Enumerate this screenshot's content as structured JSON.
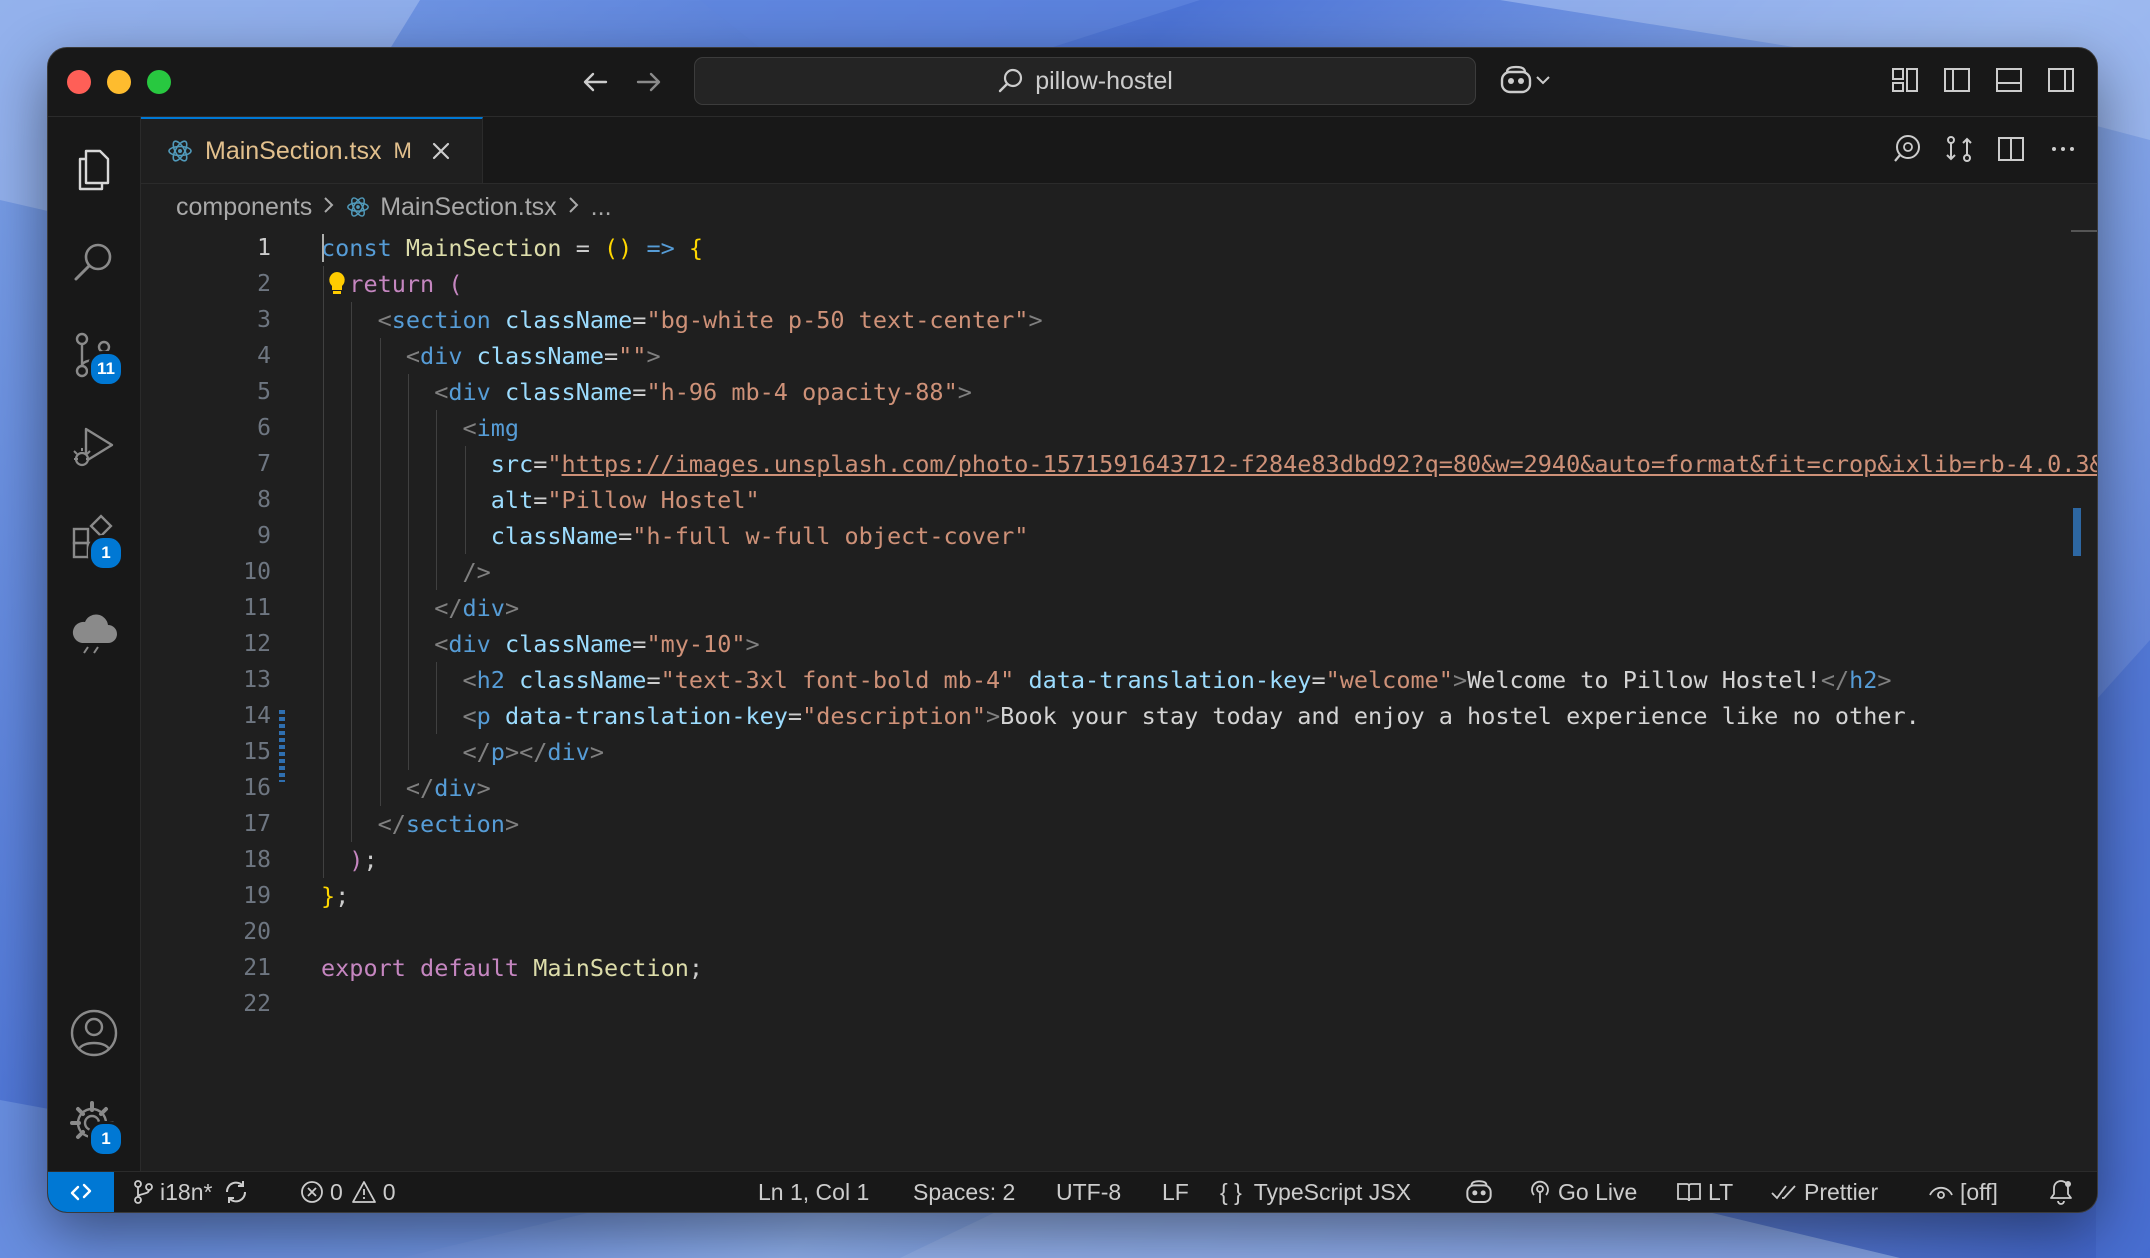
{
  "titlebar": {
    "search_text": "pillow-hostel"
  },
  "activitybar": {
    "source_control_badge": "11",
    "extensions_badge": "1",
    "settings_badge": "1"
  },
  "tab": {
    "filename": "MainSection.tsx",
    "status": "M"
  },
  "breadcrumb": {
    "folder": "components",
    "file": "MainSection.tsx",
    "more": "..."
  },
  "editor": {
    "line_numbers": [
      "1",
      "2",
      "3",
      "4",
      "5",
      "6",
      "7",
      "8",
      "9",
      "10",
      "11",
      "12",
      "13",
      "14",
      "15",
      "16",
      "17",
      "18",
      "19",
      "20",
      "21",
      "22"
    ],
    "lines": [
      [
        {
          "c": "kw",
          "t": "const"
        },
        {
          "c": "punc",
          "t": " "
        },
        {
          "c": "fn",
          "t": "MainSection"
        },
        {
          "c": "punc",
          "t": " = "
        },
        {
          "c": "paren",
          "t": "()"
        },
        {
          "c": "punc",
          "t": " "
        },
        {
          "c": "kw",
          "t": "=>"
        },
        {
          "c": "punc",
          "t": " "
        },
        {
          "c": "paren",
          "t": "{"
        }
      ],
      [
        {
          "c": "punc",
          "t": "  "
        },
        {
          "c": "kw2",
          "t": "return"
        },
        {
          "c": "punc",
          "t": " "
        },
        {
          "c": "kw2",
          "t": "("
        }
      ],
      [
        {
          "c": "punc",
          "t": "    "
        },
        {
          "c": "ang",
          "t": "<"
        },
        {
          "c": "tag",
          "t": "section"
        },
        {
          "c": "punc",
          "t": " "
        },
        {
          "c": "attr",
          "t": "className"
        },
        {
          "c": "punc",
          "t": "="
        },
        {
          "c": "str",
          "t": "\"bg-white p-50 text-center\""
        },
        {
          "c": "ang",
          "t": ">"
        }
      ],
      [
        {
          "c": "punc",
          "t": "      "
        },
        {
          "c": "ang",
          "t": "<"
        },
        {
          "c": "tag",
          "t": "div"
        },
        {
          "c": "punc",
          "t": " "
        },
        {
          "c": "attr",
          "t": "className"
        },
        {
          "c": "punc",
          "t": "="
        },
        {
          "c": "str",
          "t": "\"\""
        },
        {
          "c": "ang",
          "t": ">"
        }
      ],
      [
        {
          "c": "punc",
          "t": "        "
        },
        {
          "c": "ang",
          "t": "<"
        },
        {
          "c": "tag",
          "t": "div"
        },
        {
          "c": "punc",
          "t": " "
        },
        {
          "c": "attr",
          "t": "className"
        },
        {
          "c": "punc",
          "t": "="
        },
        {
          "c": "str",
          "t": "\"h-96 mb-4 opacity-88\""
        },
        {
          "c": "ang",
          "t": ">"
        }
      ],
      [
        {
          "c": "punc",
          "t": "          "
        },
        {
          "c": "ang",
          "t": "<"
        },
        {
          "c": "tag",
          "t": "img"
        }
      ],
      [
        {
          "c": "punc",
          "t": "            "
        },
        {
          "c": "attr",
          "t": "src"
        },
        {
          "c": "punc",
          "t": "="
        },
        {
          "c": "str",
          "t": "\""
        },
        {
          "c": "url",
          "t": "https://images.unsplash.com/photo-1571591643712-f284e83dbd92?q=80&w=2940&auto=format&fit=crop&ixlib=rb-4.0.3&"
        }
      ],
      [
        {
          "c": "punc",
          "t": "            "
        },
        {
          "c": "attr",
          "t": "alt"
        },
        {
          "c": "punc",
          "t": "="
        },
        {
          "c": "str",
          "t": "\"Pillow Hostel\""
        }
      ],
      [
        {
          "c": "punc",
          "t": "            "
        },
        {
          "c": "attr",
          "t": "className"
        },
        {
          "c": "punc",
          "t": "="
        },
        {
          "c": "str",
          "t": "\"h-full w-full object-cover\""
        }
      ],
      [
        {
          "c": "punc",
          "t": "          "
        },
        {
          "c": "ang",
          "t": "/>"
        }
      ],
      [
        {
          "c": "punc",
          "t": "        "
        },
        {
          "c": "ang",
          "t": "</"
        },
        {
          "c": "tag",
          "t": "div"
        },
        {
          "c": "ang",
          "t": ">"
        }
      ],
      [
        {
          "c": "punc",
          "t": "        "
        },
        {
          "c": "ang",
          "t": "<"
        },
        {
          "c": "tag",
          "t": "div"
        },
        {
          "c": "punc",
          "t": " "
        },
        {
          "c": "attr",
          "t": "className"
        },
        {
          "c": "punc",
          "t": "="
        },
        {
          "c": "str",
          "t": "\"my-10\""
        },
        {
          "c": "ang",
          "t": ">"
        }
      ],
      [
        {
          "c": "punc",
          "t": "          "
        },
        {
          "c": "ang",
          "t": "<"
        },
        {
          "c": "tag",
          "t": "h2"
        },
        {
          "c": "punc",
          "t": " "
        },
        {
          "c": "attr",
          "t": "className"
        },
        {
          "c": "punc",
          "t": "="
        },
        {
          "c": "str",
          "t": "\"text-3xl font-bold mb-4\""
        },
        {
          "c": "punc",
          "t": " "
        },
        {
          "c": "attr",
          "t": "data-translation-key"
        },
        {
          "c": "punc",
          "t": "="
        },
        {
          "c": "str",
          "t": "\"welcome\""
        },
        {
          "c": "ang",
          "t": ">"
        },
        {
          "c": "txt",
          "t": "Welcome to Pillow Hostel!"
        },
        {
          "c": "ang",
          "t": "</"
        },
        {
          "c": "tag",
          "t": "h2"
        },
        {
          "c": "ang",
          "t": ">"
        }
      ],
      [
        {
          "c": "punc",
          "t": "          "
        },
        {
          "c": "ang",
          "t": "<"
        },
        {
          "c": "tag",
          "t": "p"
        },
        {
          "c": "punc",
          "t": " "
        },
        {
          "c": "attr",
          "t": "data-translation-key"
        },
        {
          "c": "punc",
          "t": "="
        },
        {
          "c": "str",
          "t": "\"description\""
        },
        {
          "c": "ang",
          "t": ">"
        },
        {
          "c": "txt",
          "t": "Book your stay today and enjoy a hostel experience like no other."
        }
      ],
      [
        {
          "c": "punc",
          "t": "          "
        },
        {
          "c": "ang",
          "t": "</"
        },
        {
          "c": "tag",
          "t": "p"
        },
        {
          "c": "ang",
          "t": "></"
        },
        {
          "c": "tag",
          "t": "div"
        },
        {
          "c": "ang",
          "t": ">"
        }
      ],
      [
        {
          "c": "punc",
          "t": "      "
        },
        {
          "c": "ang",
          "t": "</"
        },
        {
          "c": "tag",
          "t": "div"
        },
        {
          "c": "ang",
          "t": ">"
        }
      ],
      [
        {
          "c": "punc",
          "t": "    "
        },
        {
          "c": "ang",
          "t": "</"
        },
        {
          "c": "tag",
          "t": "section"
        },
        {
          "c": "ang",
          "t": ">"
        }
      ],
      [
        {
          "c": "punc",
          "t": "  "
        },
        {
          "c": "kw2",
          "t": ")"
        },
        {
          "c": "punc",
          "t": ";"
        }
      ],
      [
        {
          "c": "paren",
          "t": "}"
        },
        {
          "c": "punc",
          "t": ";"
        }
      ],
      [],
      [
        {
          "c": "kw2",
          "t": "export"
        },
        {
          "c": "punc",
          "t": " "
        },
        {
          "c": "kw2",
          "t": "default"
        },
        {
          "c": "punc",
          "t": " "
        },
        {
          "c": "fn",
          "t": "MainSection"
        },
        {
          "c": "punc",
          "t": ";"
        }
      ],
      []
    ]
  },
  "statusbar": {
    "branch": "i18n*",
    "errors": "0",
    "warnings": "0",
    "position": "Ln 1, Col 1",
    "spaces": "Spaces: 2",
    "encoding": "UTF-8",
    "eol": "LF",
    "language": "TypeScript JSX",
    "golive": "Go Live",
    "lt": "LT",
    "prettier": "Prettier",
    "off": "[off]"
  }
}
